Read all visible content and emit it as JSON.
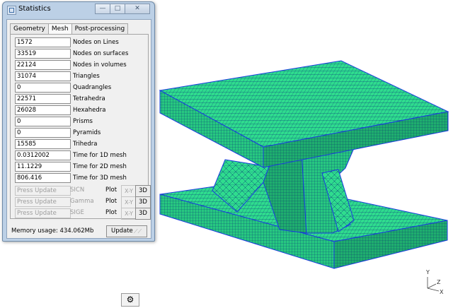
{
  "window": {
    "title": "Statistics",
    "minimize": "—",
    "maximize": "□",
    "close": "✕"
  },
  "tabs": [
    "Geometry",
    "Mesh",
    "Post-processing"
  ],
  "active_tab": "Mesh",
  "stats": [
    {
      "value": "1572",
      "label": "Nodes on Lines"
    },
    {
      "value": "33519",
      "label": "Nodes on surfaces"
    },
    {
      "value": "22124",
      "label": "Nodes in volumes"
    },
    {
      "value": "31074",
      "label": "Triangles"
    },
    {
      "value": "0",
      "label": "Quadrangles"
    },
    {
      "value": "22571",
      "label": "Tetrahedra"
    },
    {
      "value": "26028",
      "label": "Hexahedra"
    },
    {
      "value": "0",
      "label": "Prisms"
    },
    {
      "value": "0",
      "label": "Pyramids"
    },
    {
      "value": "15585",
      "label": "Trihedra"
    },
    {
      "value": "0.0312002",
      "label": "Time for 1D mesh"
    },
    {
      "value": "11.1229",
      "label": "Time for 2D mesh"
    },
    {
      "value": "806.416",
      "label": "Time for 3D mesh"
    }
  ],
  "quality": [
    {
      "value": "Press Update",
      "name": "SICN",
      "plot": "Plot",
      "xy": "X-Y",
      "three_d": "3D"
    },
    {
      "value": "Press Update",
      "name": "Gamma",
      "plot": "Plot",
      "xy": "X-Y",
      "three_d": "3D"
    },
    {
      "value": "Press Update",
      "name": "SIGE",
      "plot": "Plot",
      "xy": "X-Y",
      "three_d": "3D"
    }
  ],
  "memory": "Memory usage: 434.062Mb",
  "update_label": "Update",
  "axes": {
    "y": "Y",
    "x": "X",
    "z": "Z"
  },
  "colors": {
    "mesh_fill": "#2fdc8e",
    "mesh_line": "#0a3f7a",
    "edge": "#1b3be0"
  }
}
